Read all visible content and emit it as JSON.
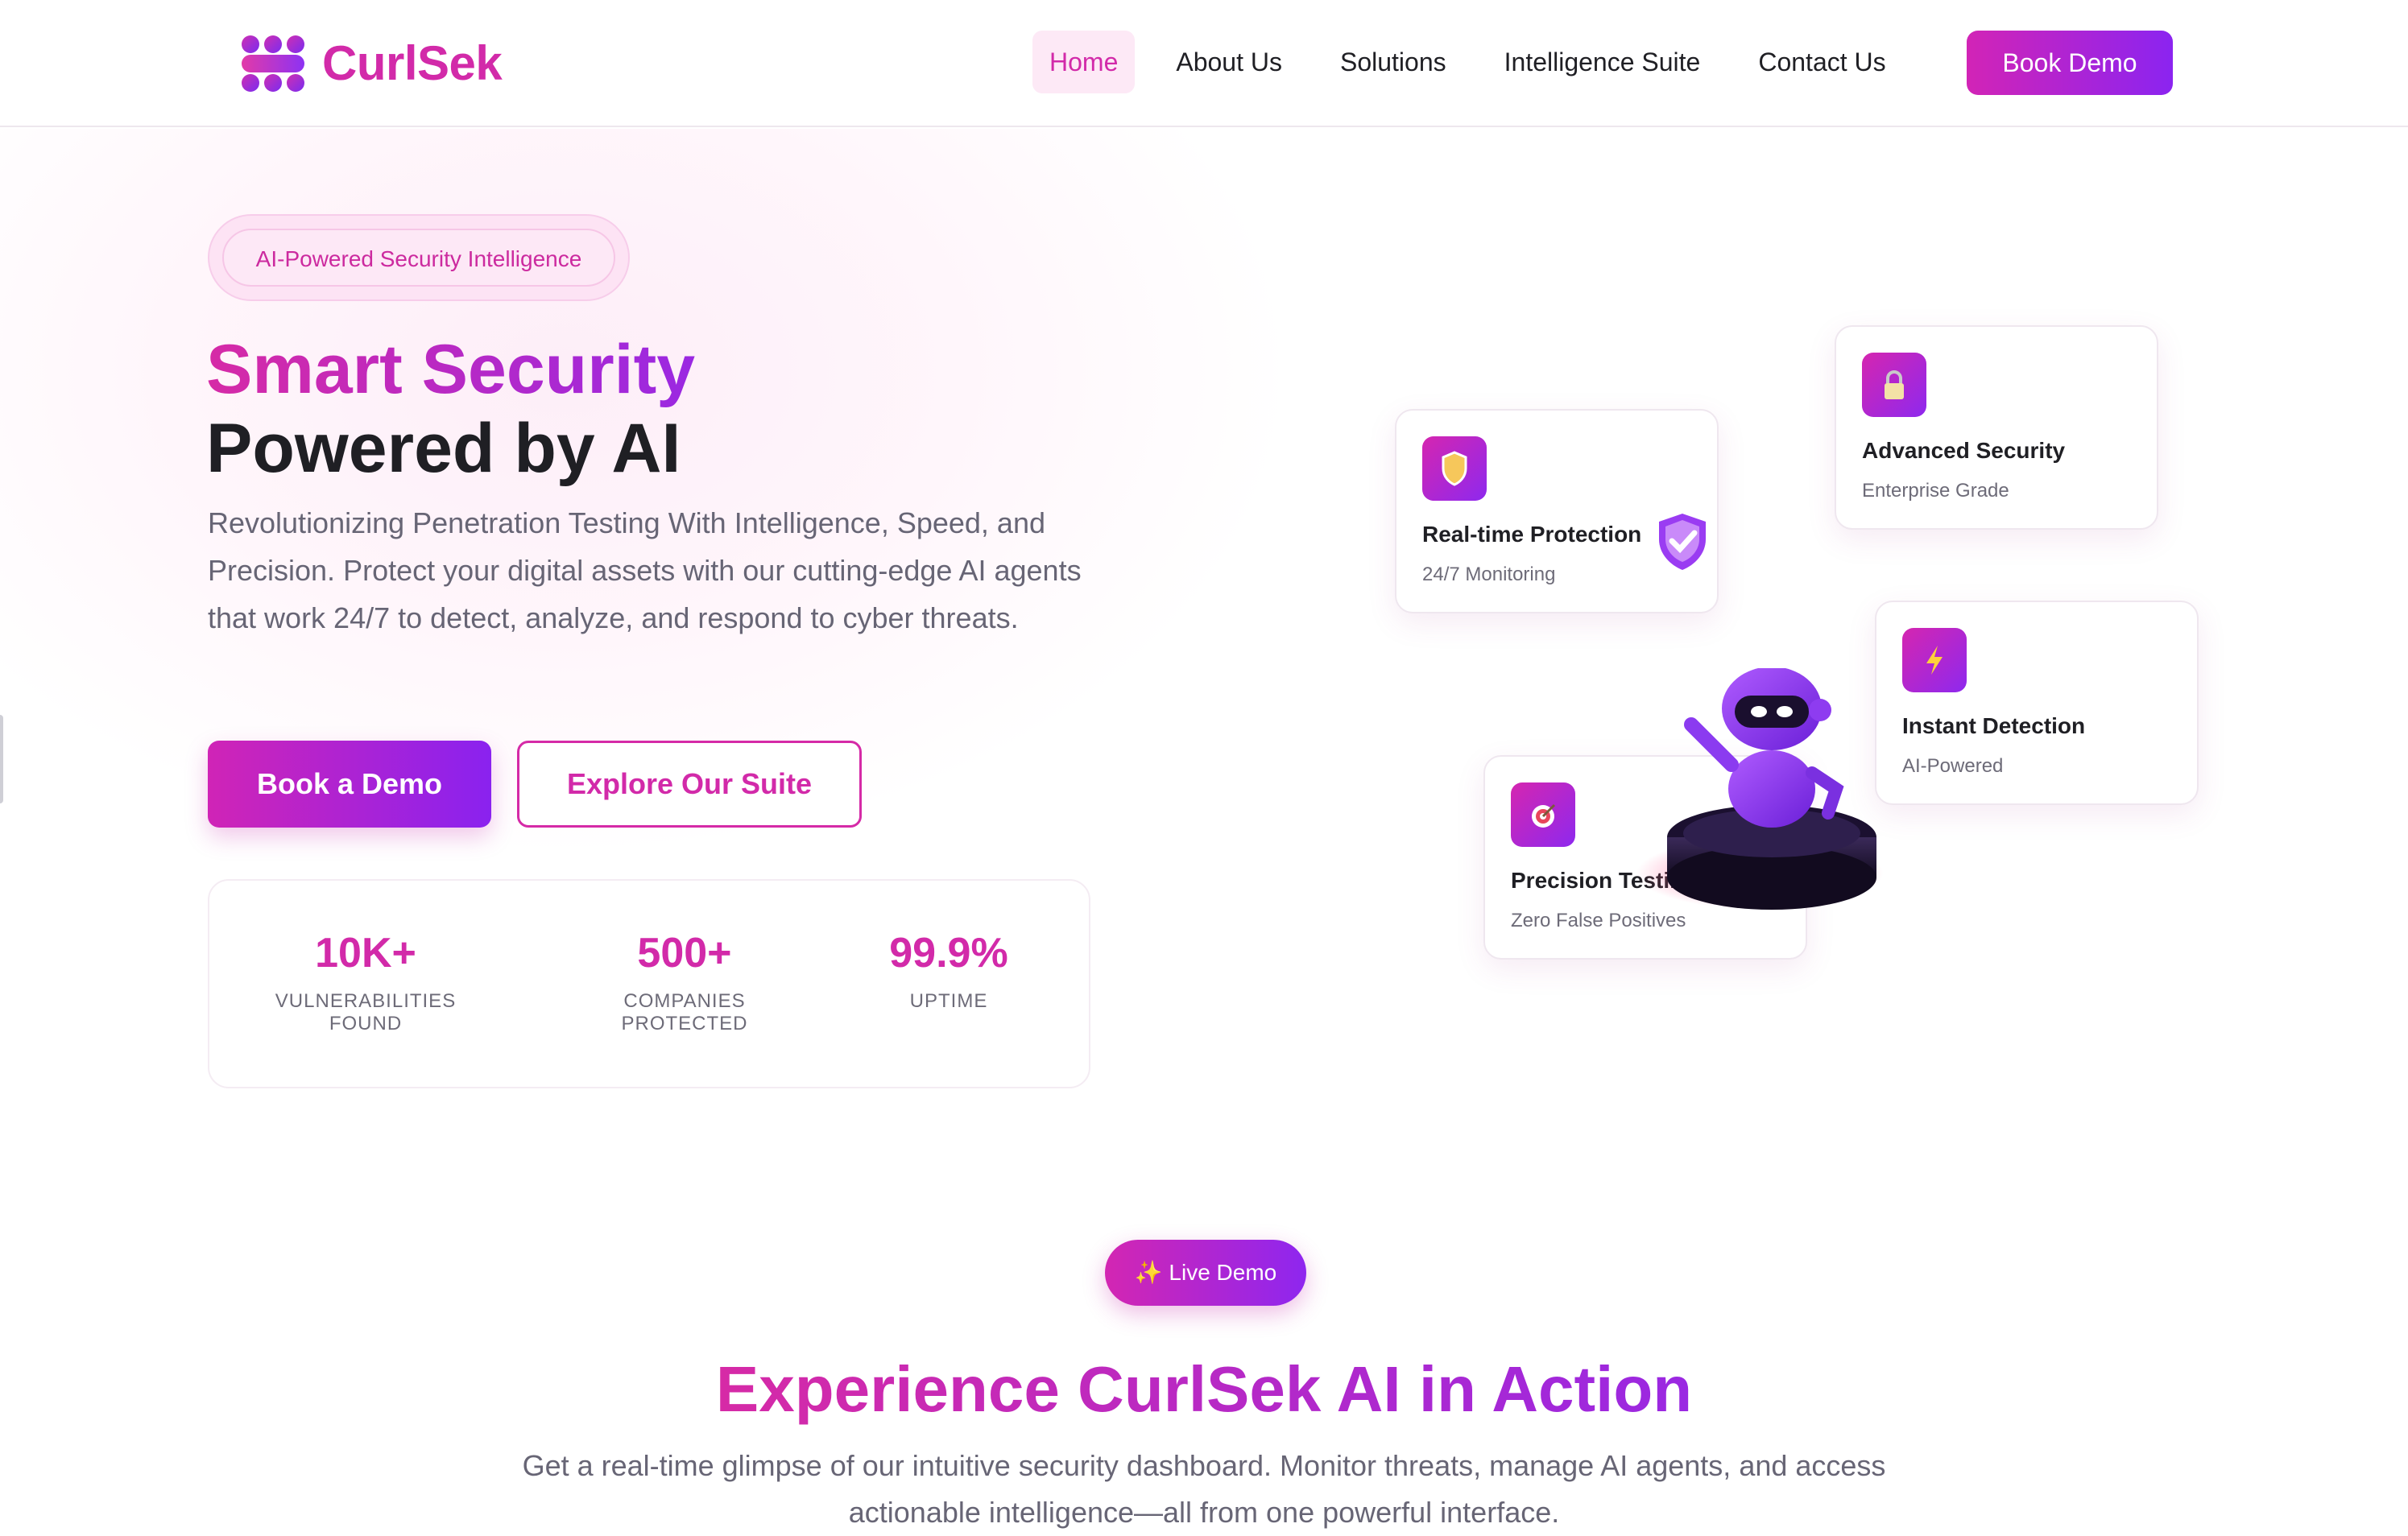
{
  "brand": {
    "name": "CurlSek",
    "accent": "#d22aa9",
    "accent2": "#8b24f0"
  },
  "nav": {
    "links": [
      "Home",
      "About Us",
      "Solutions",
      "Intelligence Suite",
      "Contact Us"
    ],
    "active": "Home",
    "cta": "Book Demo"
  },
  "hero": {
    "badge": "AI-Powered Security Intelligence",
    "title_line1": "Smart Security",
    "title_line2": "Powered by AI",
    "description": "Revolutionizing Penetration Testing With Intelligence, Speed, and Precision. Protect your digital assets with our cutting-edge AI agents that work 24/7 to detect, analyze, and respond to cyber threats.",
    "primary_button": "Book a Demo",
    "secondary_button": "Explore Our Suite",
    "stats": [
      {
        "value": "10K+",
        "label": "VULNERABILITIES FOUND"
      },
      {
        "value": "500+",
        "label": "COMPANIES PROTECTED"
      },
      {
        "value": "99.9%",
        "label": "UPTIME"
      }
    ]
  },
  "features": [
    {
      "icon": "shield-icon",
      "title": "Real-time Protection",
      "subtitle": "24/7 Monitoring"
    },
    {
      "icon": "lock-icon",
      "title": "Advanced Security",
      "subtitle": "Enterprise Grade"
    },
    {
      "icon": "lightning-icon",
      "title": "Instant Detection",
      "subtitle": "AI-Powered"
    },
    {
      "icon": "target-icon",
      "title": "Precision Testing",
      "subtitle": "Zero False Positives"
    }
  ],
  "demo_section": {
    "pill_icon": "sparkles-icon",
    "pill": "Live Demo",
    "title": "Experience CurlSek AI in Action",
    "description": "Get a real-time glimpse of our intuitive security dashboard. Monitor threats, manage AI agents, and access actionable intelligence—all from one powerful interface."
  }
}
